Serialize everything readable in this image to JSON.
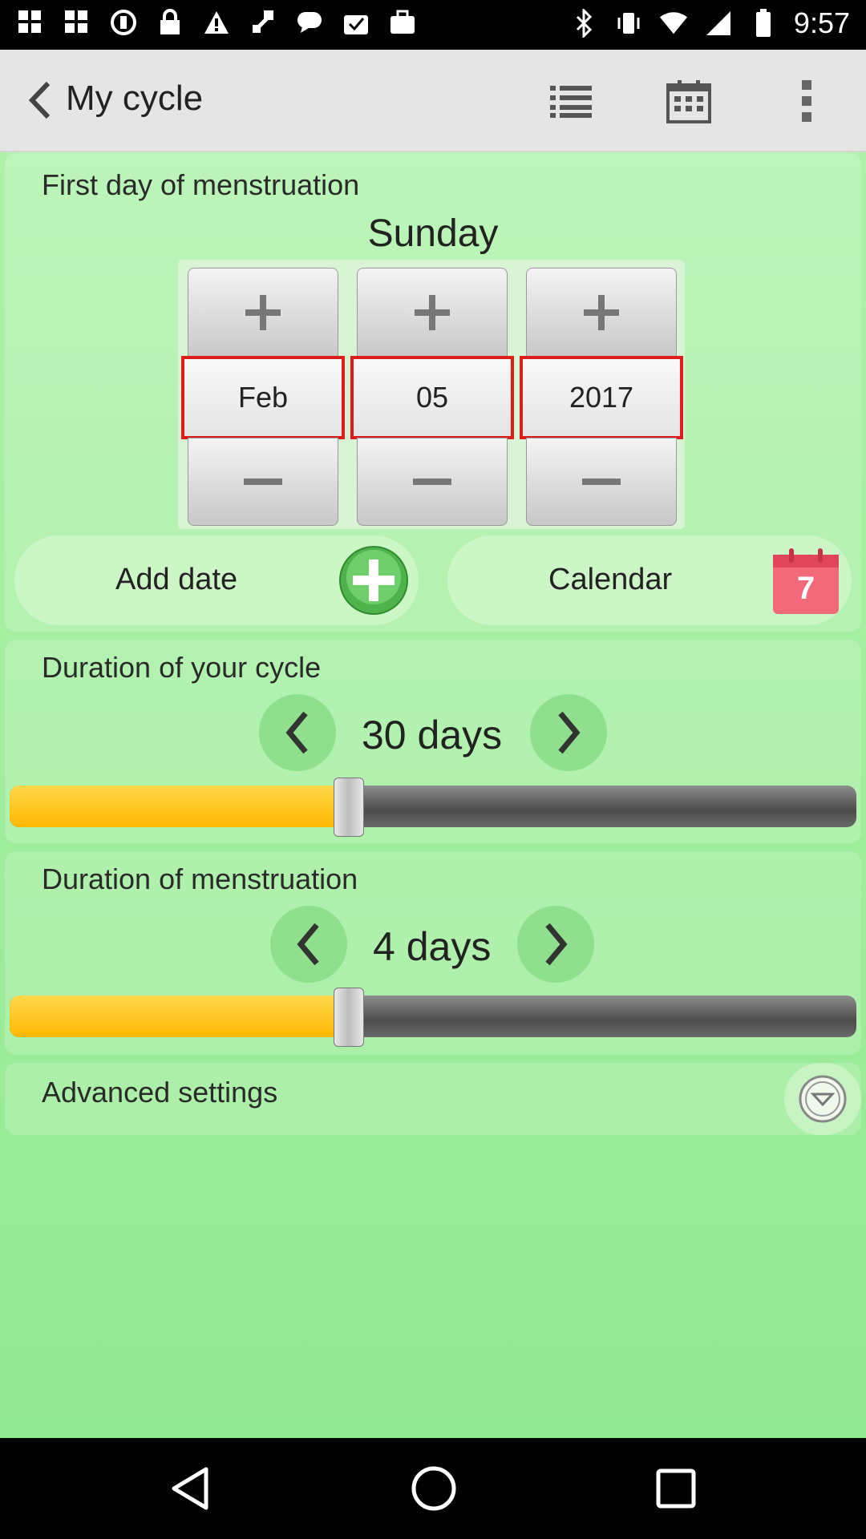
{
  "status_bar": {
    "time": "9:57",
    "left_icons": [
      "app-icon",
      "app-icon",
      "circle-icon",
      "lock-icon",
      "warning-icon",
      "gps-icon",
      "chat-icon",
      "checklist-icon",
      "briefcase-icon"
    ],
    "right_icons": [
      "bluetooth-icon",
      "vibrate-icon",
      "wifi-icon",
      "signal-icon",
      "battery-icon"
    ]
  },
  "header": {
    "title": "My cycle",
    "icons": [
      "back-arrow-icon",
      "list-icon",
      "calendar-icon",
      "more-vert-icon"
    ]
  },
  "first_day": {
    "label": "First day of menstruation",
    "weekday": "Sunday",
    "month": "Feb",
    "day": "05",
    "year": "2017"
  },
  "actions": {
    "add_date": "Add date",
    "calendar": "Calendar",
    "calendar_icon_number": "7"
  },
  "cycle": {
    "label": "Duration of your cycle",
    "value": "30 days",
    "slider_level": 0.4
  },
  "menstruation": {
    "label": "Duration of menstruation",
    "value": "4 days",
    "slider_level": 0.4
  },
  "advanced": {
    "label": "Advanced settings"
  },
  "colors": {
    "background": "#8fe98f",
    "slider_fill": "#ffc100",
    "highlight_border": "#dd1c1c"
  }
}
